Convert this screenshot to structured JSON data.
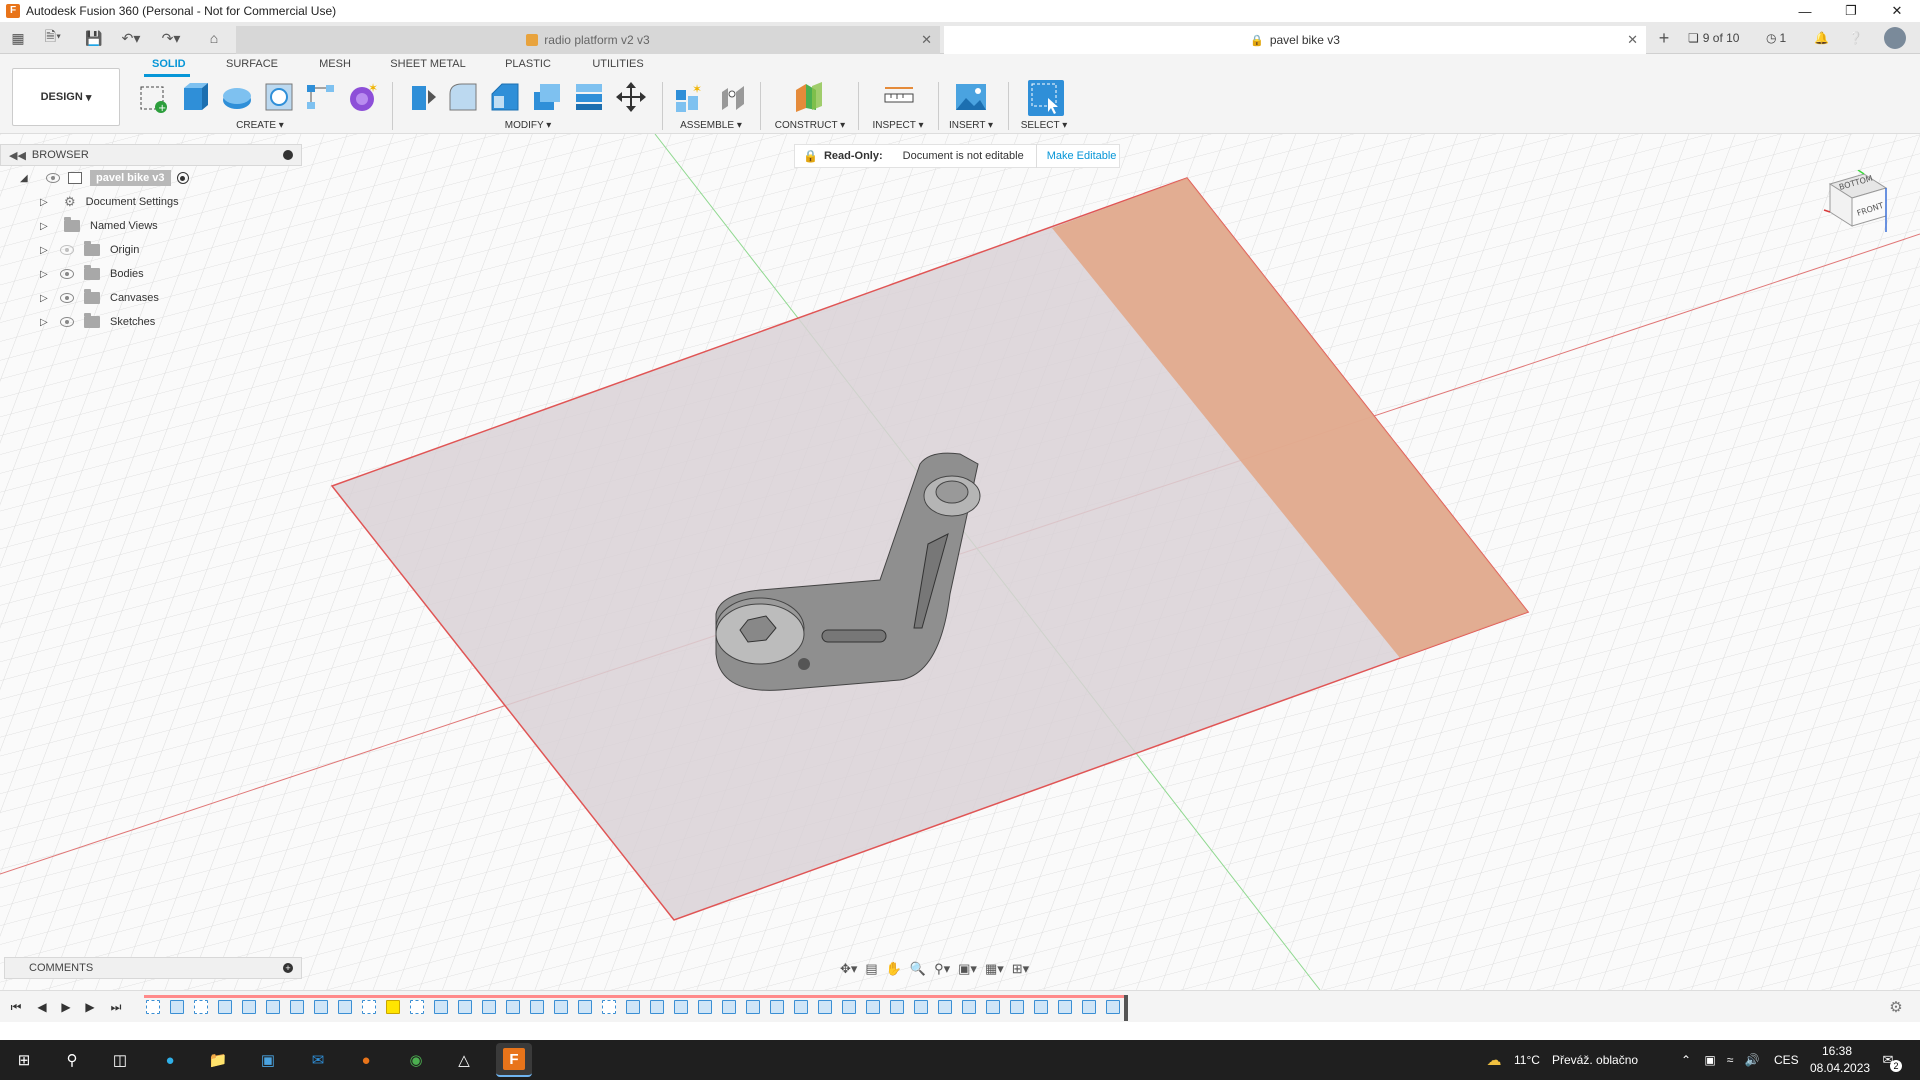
{
  "window": {
    "title": "Autodesk Fusion 360 (Personal - Not for Commercial Use)",
    "controls": [
      "minimize-icon",
      "restore-icon",
      "close-icon"
    ]
  },
  "tabs": {
    "inactive_label": "radio platform v2 v3",
    "active_label": "pavel bike v3",
    "version_counter": "9 of 10",
    "jobs_count": "1"
  },
  "toolbar": {
    "workspace": "DESIGN",
    "workspace_tabs": [
      "SOLID",
      "SURFACE",
      "MESH",
      "SHEET METAL",
      "PLASTIC",
      "UTILITIES"
    ],
    "groups": [
      "CREATE",
      "MODIFY",
      "ASSEMBLE",
      "CONSTRUCT",
      "INSPECT",
      "INSERT",
      "SELECT"
    ]
  },
  "browser": {
    "header": "BROWSER",
    "root": "pavel bike v3",
    "items": [
      {
        "label": "Document Settings",
        "icon": "gear-icon"
      },
      {
        "label": "Named Views",
        "icon": "folder-icon"
      },
      {
        "label": "Origin",
        "icon": "folder-icon"
      },
      {
        "label": "Bodies",
        "icon": "folder-icon"
      },
      {
        "label": "Canvases",
        "icon": "folder-icon"
      },
      {
        "label": "Sketches",
        "icon": "folder-icon"
      }
    ]
  },
  "readonly": {
    "label": "Read-Only:",
    "message": "Document is not editable",
    "action": "Make Editable"
  },
  "viewcube": {
    "top_label": "BOTTOM",
    "front_label": "FRONT"
  },
  "comments": {
    "header": "COMMENTS"
  },
  "taskbar": {
    "weather_temp": "11°C",
    "weather_text": "Převáž. oblačno",
    "language": "CES",
    "time": "16:38",
    "date": "08.04.2023",
    "notifications": "2"
  }
}
